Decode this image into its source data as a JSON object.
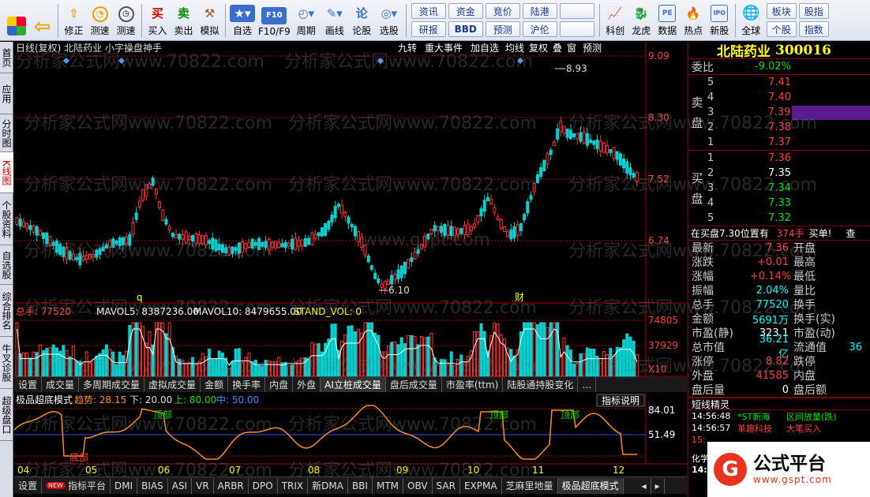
{
  "toolbar": {
    "buttons": [
      {
        "name": "home",
        "label": ""
      },
      {
        "name": "back",
        "label": ""
      },
      {
        "name": "modify",
        "label": "修正"
      },
      {
        "name": "speedtest",
        "label": "测速"
      },
      {
        "name": "buy",
        "label": "买入"
      },
      {
        "name": "sell",
        "label": "卖出"
      },
      {
        "name": "simulate",
        "label": "模拟"
      },
      {
        "name": "watchlist",
        "label": "自选"
      },
      {
        "name": "f10",
        "label": "F10/F9"
      },
      {
        "name": "period",
        "label": "周期"
      },
      {
        "name": "draw",
        "label": "画线"
      },
      {
        "name": "board",
        "label": "论股"
      },
      {
        "name": "select",
        "label": "选股"
      }
    ],
    "grid": [
      "资讯",
      "资金",
      "竞价",
      "陆港",
      "研报",
      "BBD",
      "预测",
      "沪伦"
    ],
    "buttons2": [
      {
        "name": "kechuang",
        "label": "科创"
      },
      {
        "name": "longhu",
        "label": "龙虎"
      },
      {
        "name": "data",
        "label": "数据"
      },
      {
        "name": "hot",
        "label": "热点"
      },
      {
        "name": "ipo",
        "label": "新股"
      },
      {
        "name": "global",
        "label": "全球"
      }
    ],
    "grid2": [
      "板块",
      "股指",
      "个股",
      "指数"
    ],
    "icons": {
      "buy": "买",
      "sell": "卖",
      "f10": "F10",
      "board": "论",
      "kechuang": "科",
      "pe": "PE",
      "ipo": "IPO"
    }
  },
  "lefttabs": [
    "首页",
    "应用",
    "分时图",
    "K线图",
    "个股资料",
    "自选股",
    "综合排名",
    "牛叉诊股",
    "超级盘口"
  ],
  "kline": {
    "header": "日线(复权) 北陆药业 小字操盘神手",
    "header_buttons": [
      "九转",
      "重大事件",
      "加自选",
      "均线",
      "复权",
      "叠",
      "窗",
      "预测"
    ],
    "high_label": "8.93",
    "low_label": "6.10",
    "price_axis": [
      "9.09",
      "8.30",
      "7.52",
      "6.74"
    ],
    "markers": [
      "q",
      "财"
    ]
  },
  "volume": {
    "header": {
      "total": "总手: 77520",
      "mavol5": "MAVOL5: 8387236.00",
      "mavol10": "MAVOL10: 8479655.00",
      "stand": "STAND_VOL: 0"
    },
    "axis": [
      "74805",
      "37929",
      "X10"
    ]
  },
  "subtabs": [
    "设置",
    "成交量",
    "多周期成交量",
    "虚拟成交量",
    "金额",
    "换手率",
    "内盘",
    "外盘",
    "AI立桩成交量",
    "盘后成交量",
    "市盈率(ttm)",
    "陆股通持股变化",
    "…",
    "指标说明"
  ],
  "osc": {
    "title": "极品超底模式",
    "trend": "趋势: 28.15",
    "lower": "下: 20.00",
    "upper": "上: 80.00",
    "mid": "中: 50.00",
    "axis": [
      "84.01",
      "51.49"
    ],
    "labels": [
      "顶部",
      "顶部",
      "顶部",
      "底部"
    ],
    "months": [
      "04",
      "05",
      "06",
      "07",
      "08",
      "09",
      "10",
      "11",
      "12"
    ]
  },
  "bottomtabs": [
    "设置",
    "NEW",
    "指标平台",
    "DMI",
    "BIAS",
    "ASI",
    "VR",
    "ARBR",
    "DPO",
    "TRIX",
    "新DMA",
    "BBI",
    "MTM",
    "OBV",
    "SAR",
    "EXPMA",
    "芝麻里地量",
    "极品超底模式"
  ],
  "stock": {
    "name": "北陆药业",
    "code": "300016",
    "weibi_label": "委比",
    "weibi": "-9.02%",
    "sell_label": "卖盘",
    "buy_label": "买盘",
    "asks": [
      {
        "level": "5",
        "price": "7.41"
      },
      {
        "level": "4",
        "price": "7.40"
      },
      {
        "level": "3",
        "price": "7.39"
      },
      {
        "level": "2",
        "price": "7.38"
      },
      {
        "level": "1",
        "price": "7.37"
      }
    ],
    "bids": [
      {
        "level": "1",
        "price": "7.36"
      },
      {
        "level": "2",
        "price": "7.35"
      },
      {
        "level": "3",
        "price": "7.34"
      },
      {
        "level": "4",
        "price": "7.33"
      },
      {
        "level": "5",
        "price": "7.32"
      }
    ],
    "bid_notice": "在买盘7.30位置有",
    "bid_notice_qty": "374手",
    "bid_notice_tail": "买单!",
    "bid_notice_btn": "查",
    "quotes": [
      {
        "l1": "最新",
        "v1": "7.36",
        "c1": "red",
        "l2": "开盘",
        "v2": ""
      },
      {
        "l1": "涨跌",
        "v1": "+0.01",
        "c1": "red",
        "l2": "最高",
        "v2": ""
      },
      {
        "l1": "涨幅",
        "v1": "+0.14%",
        "c1": "red",
        "l2": "最低",
        "v2": ""
      },
      {
        "l1": "振幅",
        "v1": "2.04%",
        "c1": "cyan",
        "l2": "量比",
        "v2": ""
      },
      {
        "l1": "总手",
        "v1": "77520",
        "c1": "cyan",
        "l2": "换手",
        "v2": ""
      },
      {
        "l1": "金额",
        "v1": "5691万",
        "c1": "cyan",
        "l2": "换手(实)",
        "v2": ""
      },
      {
        "l1": "市盈(静)",
        "v1": "323.1",
        "c1": "white",
        "l2": "市盈(动)",
        "v2": ""
      },
      {
        "l1": "总市值",
        "v1": "36.21亿",
        "c1": "cyan",
        "l2": "流通值",
        "v2": "36"
      },
      {
        "l1": "涨停",
        "v1": "8.82",
        "c1": "red",
        "l2": "跌停",
        "v2": ""
      },
      {
        "l1": "外盘",
        "v1": "41585",
        "c1": "red",
        "l2": "内盘",
        "v2": ""
      },
      {
        "l1": "盘后量",
        "v1": "0",
        "c1": "white",
        "l2": "盘后额",
        "v2": ""
      }
    ],
    "ticks_title": "短线精灵",
    "ticks": [
      {
        "time": "14:56:48",
        "name": "*ST新海",
        "event": "区间放量(跌)"
      },
      {
        "time": "14:56:57",
        "name": "革趣科技",
        "event": "大笔买入"
      },
      {
        "time": "15:",
        "name": "",
        "event": ""
      }
    ],
    "tail1": "化学",
    "tail2": "14:"
  },
  "logo": {
    "mark": "G",
    "title": "公式平台",
    "url": "www.gspt.com"
  },
  "watermarks": [
    "分析家公式网www.70822.com",
    "www.gspt.com"
  ],
  "colors": {
    "up": "#ff3232",
    "down": "#00d2d2",
    "ma5": "#ffffff",
    "osc_line": "#ff8c1a",
    "mid_line": "#3050ff"
  }
}
